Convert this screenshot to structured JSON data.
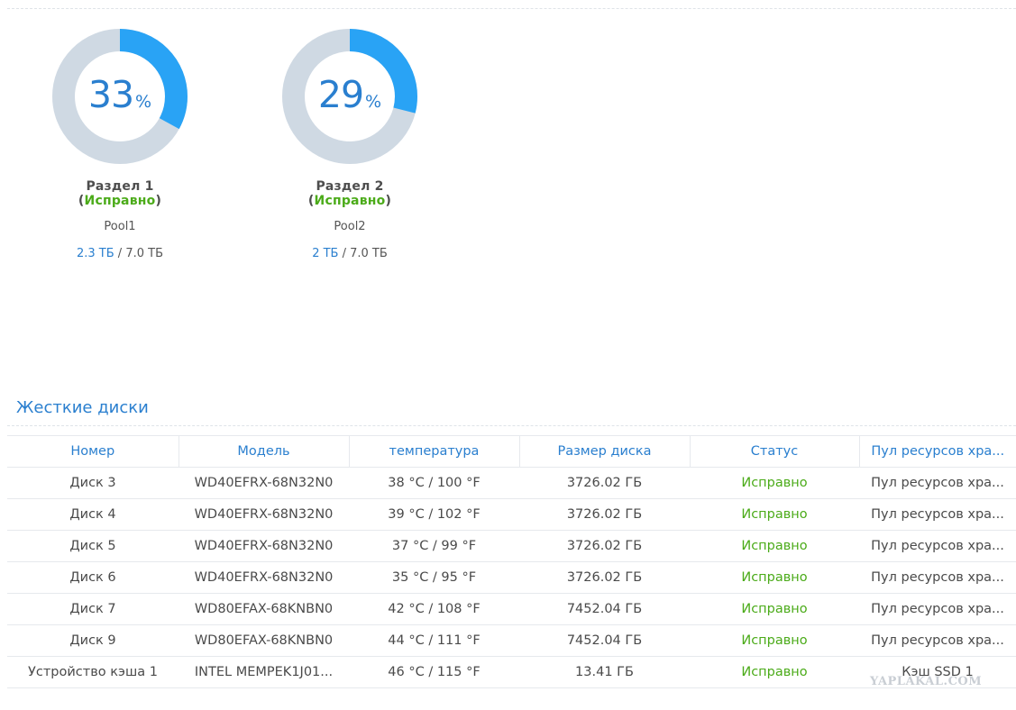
{
  "pools": [
    {
      "percent": "33",
      "percent_value": 33,
      "percent_sign": "%",
      "title_prefix": "Раздел 1 (",
      "status": "Исправно",
      "title_suffix": ")",
      "name": "Pool1",
      "used": "2.3 ТБ",
      "total": " / 7.0 ТБ"
    },
    {
      "percent": "29",
      "percent_value": 29,
      "percent_sign": "%",
      "title_prefix": "Раздел 2 (",
      "status": "Исправно",
      "title_suffix": ")",
      "name": "Pool2",
      "used": "2 ТБ",
      "total": " / 7.0 ТБ"
    }
  ],
  "colors": {
    "accent": "#2a7fcf",
    "donut_fill": "#29a3f5",
    "donut_track": "#cfd9e3",
    "healthy": "#4bab19"
  },
  "section_title": "Жесткие диски",
  "table": {
    "headers": [
      "Номер",
      "Модель",
      "температура",
      "Размер диска",
      "Статус",
      "Пул ресурсов хра..."
    ],
    "rows": [
      [
        "Диск 3",
        "WD40EFRX-68N32N0",
        "38 °C / 100 °F",
        "3726.02 ГБ",
        "Исправно",
        "Пул ресурсов хра..."
      ],
      [
        "Диск 4",
        "WD40EFRX-68N32N0",
        "39 °C / 102 °F",
        "3726.02 ГБ",
        "Исправно",
        "Пул ресурсов хра..."
      ],
      [
        "Диск 5",
        "WD40EFRX-68N32N0",
        "37 °C / 99 °F",
        "3726.02 ГБ",
        "Исправно",
        "Пул ресурсов хра..."
      ],
      [
        "Диск 6",
        "WD40EFRX-68N32N0",
        "35 °C / 95 °F",
        "3726.02 ГБ",
        "Исправно",
        "Пул ресурсов хра..."
      ],
      [
        "Диск 7",
        "WD80EFAX-68KNBN0",
        "42 °C / 108 °F",
        "7452.04 ГБ",
        "Исправно",
        "Пул ресурсов хра..."
      ],
      [
        "Диск 9",
        "WD80EFAX-68KNBN0",
        "44 °C / 111 °F",
        "7452.04 ГБ",
        "Исправно",
        "Пул ресурсов хра..."
      ],
      [
        "Устройство кэша 1",
        "INTEL MEMPEK1J01...",
        "46 °C / 115 °F",
        "13.41 ГБ",
        "Исправно",
        "Кэш SSD 1"
      ]
    ]
  },
  "watermark": "YAPLAKAL.COM"
}
